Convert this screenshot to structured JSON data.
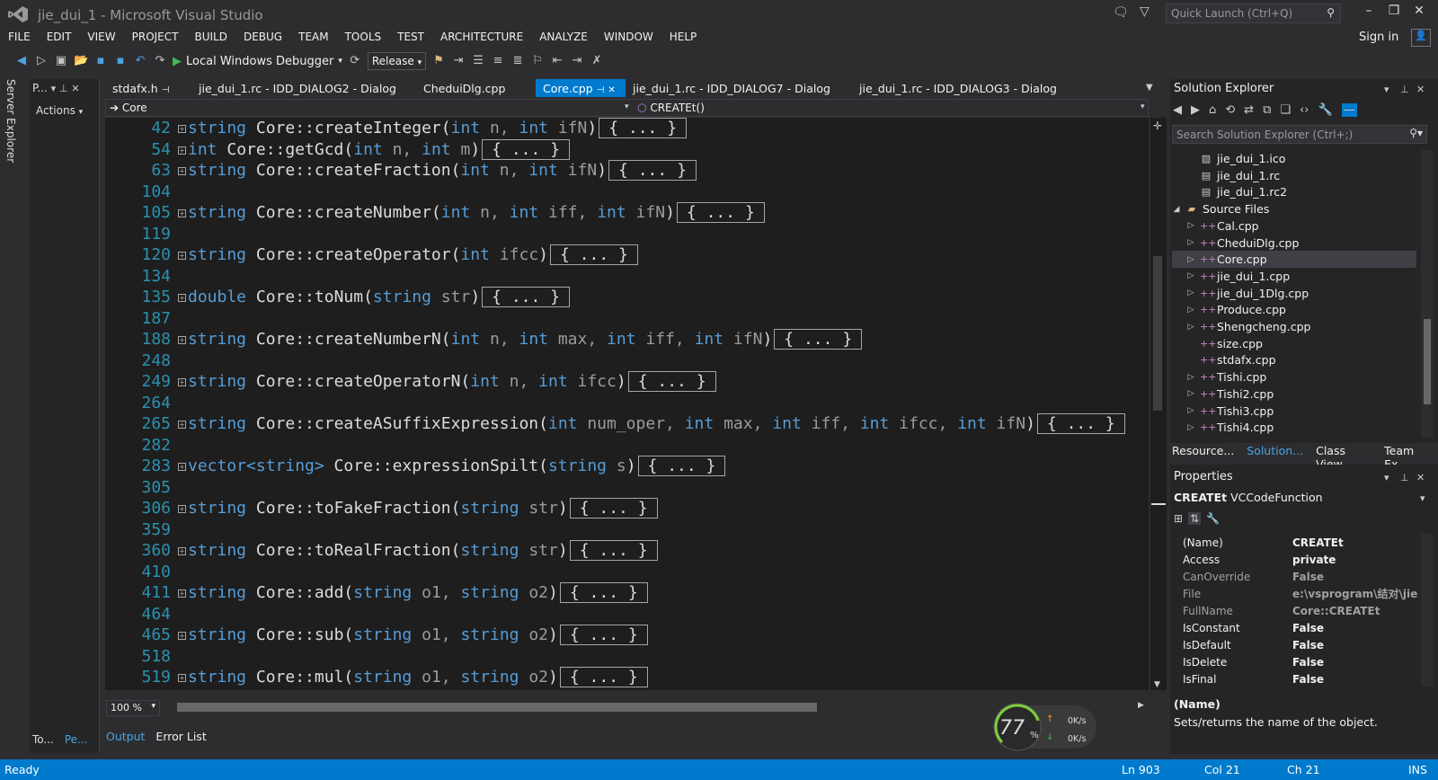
{
  "window": {
    "title": "jie_dui_1 - Microsoft Visual Studio",
    "quick_launch_placeholder": "Quick Launch (Ctrl+Q)"
  },
  "menu": [
    "FILE",
    "EDIT",
    "VIEW",
    "PROJECT",
    "BUILD",
    "DEBUG",
    "TEAM",
    "TOOLS",
    "TEST",
    "ARCHITECTURE",
    "ANALYZE",
    "WINDOW",
    "HELP"
  ],
  "account": {
    "sign_in": "Sign in"
  },
  "toolbar": {
    "debugger": "Local Windows Debugger",
    "configuration": "Release"
  },
  "left_strip": {
    "server_explorer": "Server Explorer"
  },
  "left_panel": {
    "title": "P...",
    "actions": "Actions",
    "tabs": [
      "To...",
      "Pe..."
    ]
  },
  "doc_tabs": [
    {
      "label": "stdafx.h",
      "pinned": true,
      "active": false
    },
    {
      "label": "jie_dui_1.rc - IDD_DIALOG2 - Dialog",
      "active": false
    },
    {
      "label": "CheduiDlg.cpp",
      "active": false
    },
    {
      "label": "Core.cpp",
      "active": true
    },
    {
      "label": "jie_dui_1.rc - IDD_DIALOG7 - Dialog",
      "active": false
    },
    {
      "label": "jie_dui_1.rc - IDD_DIALOG3 - Dialog",
      "active": false
    }
  ],
  "nav_bar": {
    "scope": "Core",
    "member": "CREATEt()"
  },
  "editor": {
    "zoom": "100 %",
    "lines": [
      {
        "n": "42",
        "fold": true,
        "t": "string",
        "m": " Core::createInteger(",
        "p": [
          [
            "int",
            " n, "
          ],
          [
            "int",
            " ifN"
          ]
        ],
        "e": ")"
      },
      {
        "n": "54",
        "fold": true,
        "t": "int",
        "m": " Core::getGcd(",
        "p": [
          [
            "int",
            " n, "
          ],
          [
            "int",
            " m"
          ]
        ],
        "e": ")"
      },
      {
        "n": "63",
        "fold": true,
        "t": "string",
        "m": " Core::createFraction(",
        "p": [
          [
            "int",
            " n, "
          ],
          [
            "int",
            " ifN"
          ]
        ],
        "e": ")"
      },
      {
        "n": "104",
        "fold": false
      },
      {
        "n": "105",
        "fold": true,
        "t": "string",
        "m": " Core::createNumber(",
        "p": [
          [
            "int",
            " n, "
          ],
          [
            "int",
            " iff, "
          ],
          [
            "int",
            " ifN"
          ]
        ],
        "e": ")"
      },
      {
        "n": "119",
        "fold": false
      },
      {
        "n": "120",
        "fold": true,
        "t": "string",
        "m": " Core::createOperator(",
        "p": [
          [
            "int",
            " ifcc"
          ]
        ],
        "e": ")"
      },
      {
        "n": "134",
        "fold": false
      },
      {
        "n": "135",
        "fold": true,
        "t": "double",
        "m": " Core::toNum(",
        "p": [
          [
            "string",
            " str"
          ]
        ],
        "e": ")"
      },
      {
        "n": "187",
        "fold": false
      },
      {
        "n": "188",
        "fold": true,
        "t": "string",
        "m": " Core::createNumberN(",
        "p": [
          [
            "int",
            " n, "
          ],
          [
            "int",
            " max, "
          ],
          [
            "int",
            " iff, "
          ],
          [
            "int",
            " ifN"
          ]
        ],
        "e": ")"
      },
      {
        "n": "248",
        "fold": false
      },
      {
        "n": "249",
        "fold": true,
        "t": "string",
        "m": " Core::createOperatorN(",
        "p": [
          [
            "int",
            " n, "
          ],
          [
            "int",
            " ifcc"
          ]
        ],
        "e": ")"
      },
      {
        "n": "264",
        "fold": false
      },
      {
        "n": "265",
        "fold": true,
        "t": "string",
        "m": " Core::createASuffixExpression(",
        "p": [
          [
            "int",
            " num_oper, "
          ],
          [
            "int",
            " max, "
          ],
          [
            "int",
            " iff, "
          ],
          [
            "int",
            " ifcc, "
          ],
          [
            "int",
            " ifN"
          ]
        ],
        "e": ")"
      },
      {
        "n": "282",
        "fold": false
      },
      {
        "n": "283",
        "fold": true,
        "t": "vector<string>",
        "m": " Core::expressionSpilt(",
        "p": [
          [
            "string",
            " s"
          ]
        ],
        "e": ")"
      },
      {
        "n": "305",
        "fold": false
      },
      {
        "n": "306",
        "fold": true,
        "t": "string",
        "m": " Core::toFakeFraction(",
        "p": [
          [
            "string",
            " str"
          ]
        ],
        "e": ")"
      },
      {
        "n": "359",
        "fold": false
      },
      {
        "n": "360",
        "fold": true,
        "t": "string",
        "m": " Core::toRealFraction(",
        "p": [
          [
            "string",
            " str"
          ]
        ],
        "e": ")"
      },
      {
        "n": "410",
        "fold": false
      },
      {
        "n": "411",
        "fold": true,
        "t": "string",
        "m": " Core::add(",
        "p": [
          [
            "string",
            " o1, "
          ],
          [
            "string",
            " o2"
          ]
        ],
        "e": ")"
      },
      {
        "n": "464",
        "fold": false
      },
      {
        "n": "465",
        "fold": true,
        "t": "string",
        "m": " Core::sub(",
        "p": [
          [
            "string",
            " o1, "
          ],
          [
            "string",
            " o2"
          ]
        ],
        "e": ")"
      },
      {
        "n": "518",
        "fold": false
      },
      {
        "n": "519",
        "fold": true,
        "t": "string",
        "m": " Core::mul(",
        "p": [
          [
            "string",
            " o1, "
          ],
          [
            "string",
            " o2"
          ]
        ],
        "e": ")"
      }
    ],
    "collapsed_text": "{ ... }"
  },
  "output_tabs": [
    {
      "label": "Output",
      "active": true
    },
    {
      "label": "Error List",
      "active": false
    }
  ],
  "perf_gauge": {
    "percent": "77",
    "unit": "%",
    "up": "0K/s",
    "down": "0K/s",
    "value": 77
  },
  "solution_explorer": {
    "title": "Solution Explorer",
    "search_placeholder": "Search Solution Explorer (Ctrl+;)",
    "items": [
      {
        "label": "jie_dui_1.ico",
        "level": 3,
        "icon": "image-file-icon",
        "expander": false
      },
      {
        "label": "jie_dui_1.rc",
        "level": 3,
        "icon": "resource-file-icon",
        "expander": false
      },
      {
        "label": "jie_dui_1.rc2",
        "level": 3,
        "icon": "resource-file-icon",
        "expander": false
      },
      {
        "label": "Source Files",
        "level": 2,
        "icon": "folder-icon",
        "expander": "open"
      },
      {
        "label": "Cal.cpp",
        "level": 3,
        "icon": "cpp-file-icon",
        "expander": "closed"
      },
      {
        "label": "CheduiDlg.cpp",
        "level": 3,
        "icon": "cpp-file-icon",
        "expander": "closed"
      },
      {
        "label": "Core.cpp",
        "level": 3,
        "icon": "cpp-file-icon",
        "expander": "closed",
        "selected": true
      },
      {
        "label": "jie_dui_1.cpp",
        "level": 3,
        "icon": "cpp-file-icon",
        "expander": "closed"
      },
      {
        "label": "jie_dui_1Dlg.cpp",
        "level": 3,
        "icon": "cpp-file-icon",
        "expander": "closed"
      },
      {
        "label": "Produce.cpp",
        "level": 3,
        "icon": "cpp-file-icon",
        "expander": "closed"
      },
      {
        "label": "Shengcheng.cpp",
        "level": 3,
        "icon": "cpp-file-icon",
        "expander": "closed"
      },
      {
        "label": "size.cpp",
        "level": 3,
        "icon": "cpp-file-icon",
        "expander": false
      },
      {
        "label": "stdafx.cpp",
        "level": 3,
        "icon": "cpp-file-icon",
        "expander": false
      },
      {
        "label": "Tishi.cpp",
        "level": 3,
        "icon": "cpp-file-icon",
        "expander": "closed"
      },
      {
        "label": "Tishi2.cpp",
        "level": 3,
        "icon": "cpp-file-icon",
        "expander": "closed"
      },
      {
        "label": "Tishi3.cpp",
        "level": 3,
        "icon": "cpp-file-icon",
        "expander": "closed"
      },
      {
        "label": "Tishi4.cpp",
        "level": 3,
        "icon": "cpp-file-icon",
        "expander": "closed"
      }
    ],
    "tabs": [
      {
        "label": "Resource...",
        "active": false
      },
      {
        "label": "Solution...",
        "active": true
      },
      {
        "label": "Class View",
        "active": false
      },
      {
        "label": "Team Ex...",
        "active": false
      }
    ]
  },
  "properties": {
    "title": "Properties",
    "object_name": "CREATEt",
    "object_type": "VCCodeFunction",
    "rows": [
      {
        "name": "(Name)",
        "value": "CREATEt",
        "dim": false
      },
      {
        "name": "Access",
        "value": "private",
        "dim": false
      },
      {
        "name": "CanOverride",
        "value": "False",
        "dim": true
      },
      {
        "name": "File",
        "value": "e:\\vsprogram\\结对\\jie",
        "dim": true
      },
      {
        "name": "FullName",
        "value": "Core::CREATEt",
        "dim": true
      },
      {
        "name": "IsConstant",
        "value": "False",
        "dim": false
      },
      {
        "name": "IsDefault",
        "value": "False",
        "dim": false
      },
      {
        "name": "IsDelete",
        "value": "False",
        "dim": false
      },
      {
        "name": "IsFinal",
        "value": "False",
        "dim": false
      }
    ],
    "desc_name": "(Name)",
    "desc_text": "Sets/returns the name of the object."
  },
  "status": {
    "ready": "Ready",
    "line": "Ln 903",
    "col": "Col 21",
    "ch": "Ch 21",
    "mode": "INS"
  },
  "colors": {
    "accent": "#007acc",
    "bg": "#2d2d30",
    "editor_bg": "#1e1e1e",
    "keyword": "#569cd6",
    "line_number": "#2b91af"
  }
}
